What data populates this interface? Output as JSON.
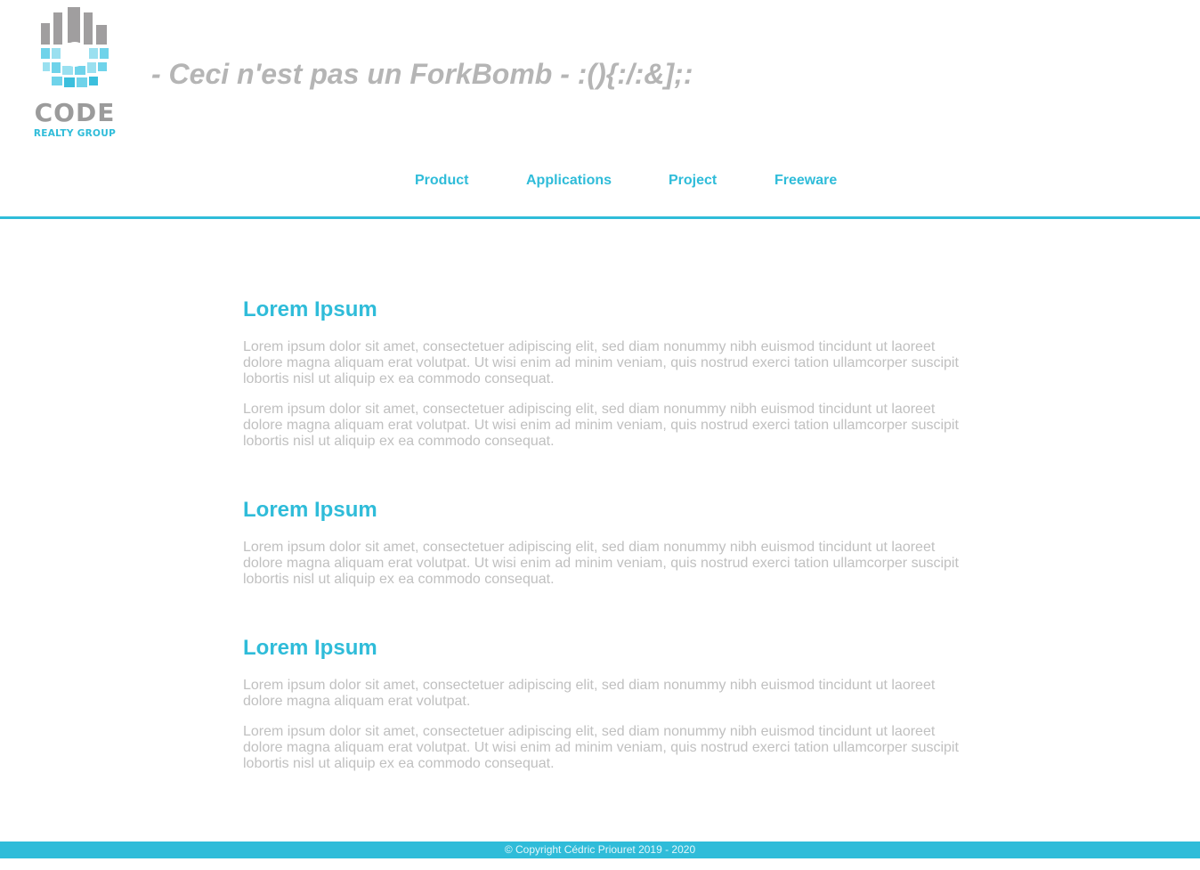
{
  "header": {
    "logo": {
      "icon": "city-skyline-grid-logo",
      "word": "CODE",
      "sub": "REALTY GROUP"
    },
    "tagline": "- Ceci n'est pas un ForkBomb - :(){:/:&];:"
  },
  "nav": {
    "items": [
      {
        "label": "Product"
      },
      {
        "label": "Applications"
      },
      {
        "label": "Project"
      },
      {
        "label": "Freeware"
      }
    ]
  },
  "sections": [
    {
      "title": "Lorem Ipsum",
      "paragraphs": [
        "Lorem ipsum dolor sit amet, consectetuer adipiscing elit, sed diam nonummy nibh euismod tincidunt ut laoreet dolore magna aliquam erat volutpat. Ut wisi enim ad minim veniam, quis nostrud exerci tation ullamcorper suscipit lobortis nisl ut aliquip ex ea commodo consequat.",
        "Lorem ipsum dolor sit amet, consectetuer adipiscing elit, sed diam nonummy nibh euismod tincidunt ut laoreet dolore magna aliquam erat volutpat. Ut wisi enim ad minim veniam, quis nostrud exerci tation ullamcorper suscipit lobortis nisl ut aliquip ex ea commodo consequat."
      ]
    },
    {
      "title": "Lorem Ipsum",
      "paragraphs": [
        "Lorem ipsum dolor sit amet, consectetuer adipiscing elit, sed diam nonummy nibh euismod tincidunt ut laoreet dolore magna aliquam erat volutpat. Ut wisi enim ad minim veniam, quis nostrud exerci tation ullamcorper suscipit lobortis nisl ut aliquip ex ea commodo consequat."
      ]
    },
    {
      "title": "Lorem Ipsum",
      "paragraphs": [
        "Lorem ipsum dolor sit amet, consectetuer adipiscing elit, sed diam nonummy nibh euismod tincidunt ut laoreet dolore magna aliquam erat volutpat.",
        "Lorem ipsum dolor sit amet, consectetuer adipiscing elit, sed diam nonummy nibh euismod tincidunt ut laoreet dolore magna aliquam erat volutpat. Ut wisi enim ad minim veniam, quis nostrud exerci tation ullamcorper suscipit lobortis nisl ut aliquip ex ea commodo consequat."
      ]
    }
  ],
  "footer": {
    "copyright": "© Copyright Cédric Priouret 2019 - 2020"
  },
  "colors": {
    "accent": "#2fbcd9",
    "logo_gray": "#a09e9f",
    "logo_blue": "#6fd3ea",
    "tagline": "#b5b5b5",
    "body_text": "#c0c0c0"
  }
}
